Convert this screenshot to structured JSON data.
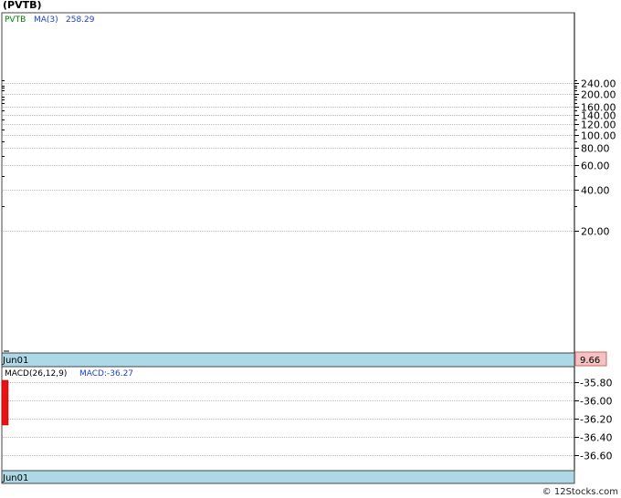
{
  "header": {
    "title": "(PVTB)"
  },
  "footer": {
    "copyright": "© 12Stocks.com"
  },
  "colors": {
    "price_label": "#008000",
    "ma_label": "#1a3fcf",
    "macd_bar": "#ee1111",
    "date_band": "#add8e6",
    "last_price_box": "#f4c2c2",
    "grid": "#bbbbbb"
  },
  "chart_data": [
    {
      "type": "line",
      "panel": "price",
      "y_scale": "log",
      "legend": {
        "ticker": "PVTB",
        "ma_label": "MA(3)",
        "ma_value": "258.29"
      },
      "y_ticks": [
        240,
        200,
        160,
        140,
        120,
        100,
        80,
        60,
        40,
        20
      ],
      "y_tick_labels": [
        "240.00",
        "200.00",
        "160.00",
        "140.00",
        "120.00",
        "100.00",
        "80.00",
        "60.00",
        "40.00",
        "20.00"
      ],
      "x_labels": [
        "Jun01"
      ],
      "last_price": "9.66",
      "series": [
        {
          "values": [
            9.66
          ]
        }
      ]
    },
    {
      "type": "bar",
      "panel": "macd",
      "legend": {
        "params": "MACD(26,12,9)",
        "macd_label": "MACD:-36.27"
      },
      "y_ticks": [
        -35.8,
        -36.0,
        -36.2,
        -36.4,
        -36.6
      ],
      "y_tick_labels": [
        "-35.80",
        "-36.00",
        "-36.20",
        "-36.40",
        "-36.60"
      ],
      "x_labels": [
        "Jun01"
      ],
      "bars": [
        {
          "x": "Jun01",
          "high": -35.78,
          "low": -36.27
        }
      ]
    }
  ]
}
